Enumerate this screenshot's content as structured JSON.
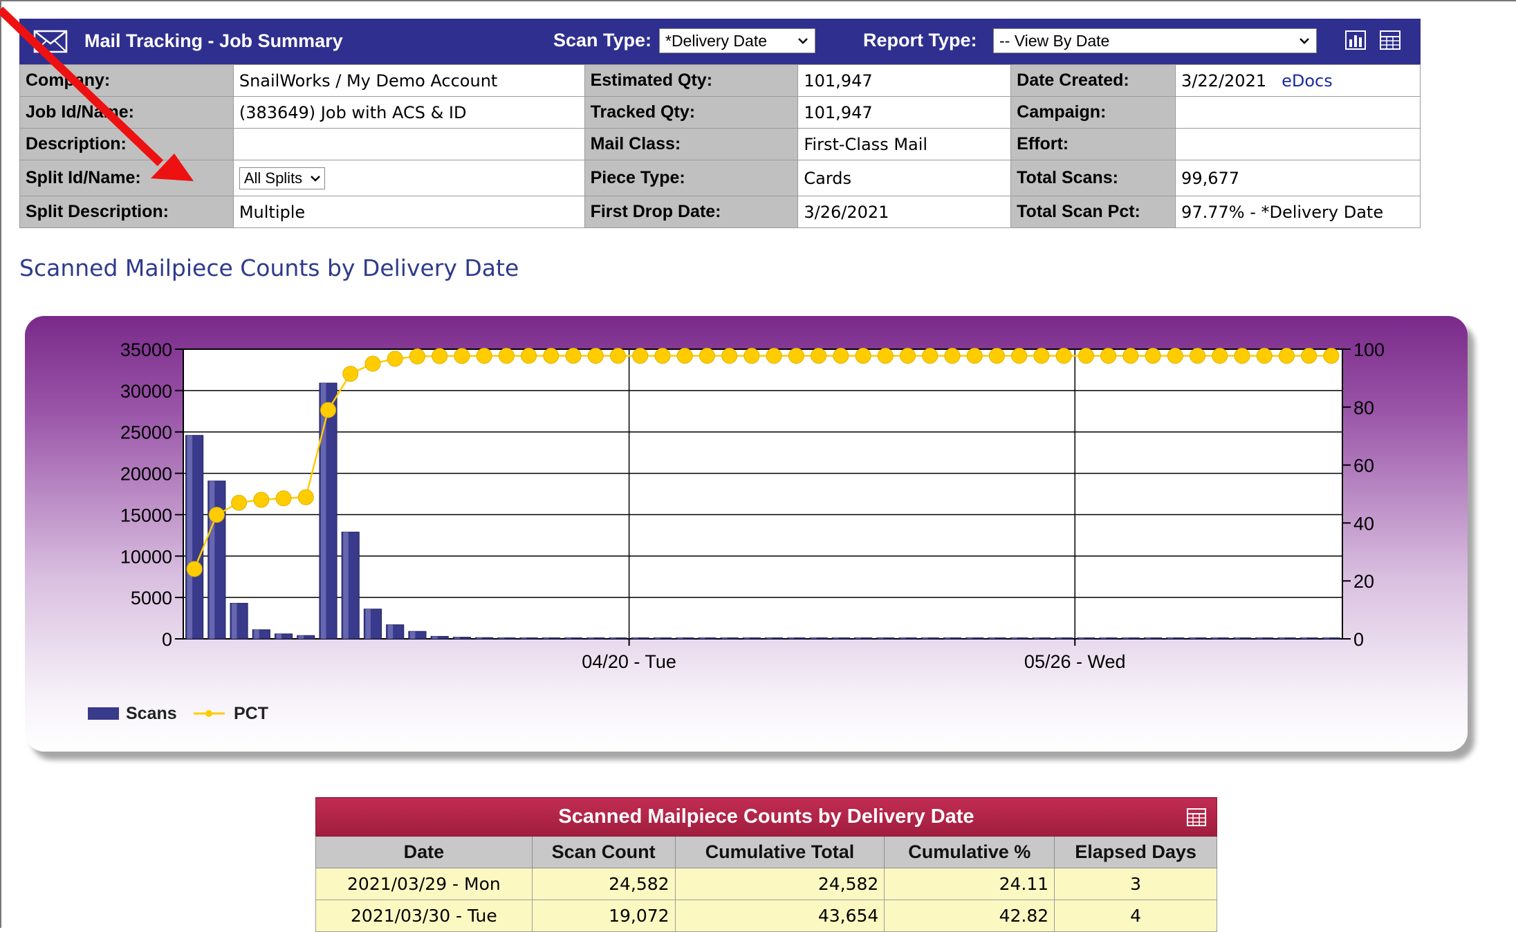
{
  "header": {
    "title": "Mail Tracking - Job Summary",
    "scan_type_label": "Scan Type:",
    "scan_type_value": "*Delivery Date",
    "report_type_label": "Report Type:",
    "report_type_value": "-- View By Date",
    "icons": [
      "mail-icon",
      "chart-icon",
      "grid-icon"
    ],
    "bar_color": "#2f2f8f"
  },
  "info": {
    "company_label": "Company:",
    "company_value": "SnailWorks / My Demo Account",
    "job_label": "Job Id/Name:",
    "job_value": "(383649) Job with ACS & ID",
    "description_label": "Description:",
    "description_value": "",
    "split_label": "Split Id/Name:",
    "split_value": "All Splits",
    "split_desc_label": "Split Description:",
    "split_desc_value": "Multiple",
    "est_qty_label": "Estimated Qty:",
    "est_qty_value": "101,947",
    "tracked_qty_label": "Tracked Qty:",
    "tracked_qty_value": "101,947",
    "mail_class_label": "Mail Class:",
    "mail_class_value": "First-Class Mail",
    "piece_type_label": "Piece Type:",
    "piece_type_value": "Cards",
    "first_drop_label": "First Drop Date:",
    "first_drop_value": "3/26/2021",
    "date_created_label": "Date Created:",
    "date_created_value": "3/22/2021",
    "edocs_link": "eDocs",
    "campaign_label": "Campaign:",
    "campaign_value": "",
    "effort_label": "Effort:",
    "effort_value": "",
    "total_scans_label": "Total Scans:",
    "total_scans_value": "99,677",
    "total_scan_pct_label": "Total Scan Pct:",
    "total_scan_pct_value": "97.77% - *Delivery Date"
  },
  "section_title": "Scanned Mailpiece Counts by Delivery Date",
  "chart_data": {
    "type": "bar",
    "x_tick_labels": [
      "04/20 - Tue",
      "05/26 - Wed"
    ],
    "x_tick_indices": [
      20,
      40
    ],
    "y_left_ticks": [
      0,
      5000,
      10000,
      15000,
      20000,
      25000,
      30000,
      35000
    ],
    "y_left_lim": [
      0,
      35000
    ],
    "y_right_ticks": [
      0,
      20,
      40,
      60,
      80,
      100
    ],
    "y_right_lim": [
      0,
      100
    ],
    "grid": true,
    "legend_position": "bottom-left",
    "series": [
      {
        "name": "Scans",
        "type": "bar",
        "axis": "left",
        "color": "#3a3a8c",
        "values": [
          24582,
          19072,
          4300,
          1100,
          600,
          400,
          30900,
          12900,
          3600,
          1700,
          900,
          300,
          200,
          150,
          120,
          100,
          90,
          80,
          70,
          60,
          60,
          50,
          50,
          45,
          40,
          40,
          35,
          30,
          30,
          30,
          25,
          25,
          20,
          20,
          20,
          20,
          15,
          15,
          15,
          15,
          15,
          15,
          10,
          10,
          10,
          10,
          10,
          10,
          10,
          10,
          10,
          10
        ]
      },
      {
        "name": "PCT",
        "type": "line",
        "axis": "right",
        "color": "#ffcc00",
        "values": [
          24.11,
          42.82,
          47,
          48,
          48.5,
          48.9,
          79,
          91.5,
          95,
          96.7,
          97.5,
          97.6,
          97.65,
          97.7,
          97.7,
          97.7,
          97.7,
          97.7,
          97.7,
          97.7,
          97.7,
          97.7,
          97.7,
          97.7,
          97.7,
          97.7,
          97.7,
          97.7,
          97.7,
          97.7,
          97.7,
          97.7,
          97.7,
          97.7,
          97.7,
          97.7,
          97.7,
          97.7,
          97.7,
          97.7,
          97.7,
          97.7,
          97.7,
          97.7,
          97.7,
          97.7,
          97.7,
          97.7,
          97.7,
          97.7,
          97.7,
          97.7
        ]
      }
    ]
  },
  "table": {
    "caption": "Scanned Mailpiece Counts by Delivery Date",
    "headers": [
      "Date",
      "Scan Count",
      "Cumulative Total",
      "Cumulative %",
      "Elapsed Days"
    ],
    "rows": [
      [
        "2021/03/29 - Mon",
        "24,582",
        "24,582",
        "24.11",
        "3"
      ],
      [
        "2021/03/30 - Tue",
        "19,072",
        "43,654",
        "42.82",
        "4"
      ]
    ]
  }
}
